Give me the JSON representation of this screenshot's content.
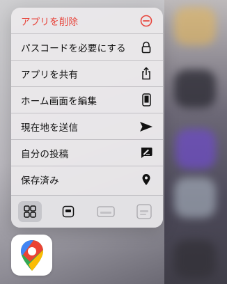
{
  "menu": {
    "items": [
      {
        "label": "アプリを削除",
        "icon": "minus-circle-icon",
        "danger": true
      },
      {
        "label": "パスコードを必要にする",
        "icon": "lock-icon"
      },
      {
        "label": "アプリを共有",
        "icon": "share-icon"
      },
      {
        "label": "ホーム画面を編集",
        "icon": "phone-icon"
      },
      {
        "label": "現在地を送信",
        "icon": "send-arrow-icon"
      },
      {
        "label": "自分の投稿",
        "icon": "edit-post-icon"
      },
      {
        "label": "保存済み",
        "icon": "map-pin-icon"
      }
    ],
    "widget_sizes": [
      {
        "icon": "widget-grid-icon",
        "selected": true
      },
      {
        "icon": "widget-small-icon"
      },
      {
        "icon": "widget-medium-icon"
      },
      {
        "icon": "widget-large-icon"
      }
    ]
  },
  "app": {
    "name": "Google Maps",
    "icon": "google-maps-icon"
  },
  "colors": {
    "danger": "#e8453c",
    "text": "#111111"
  }
}
